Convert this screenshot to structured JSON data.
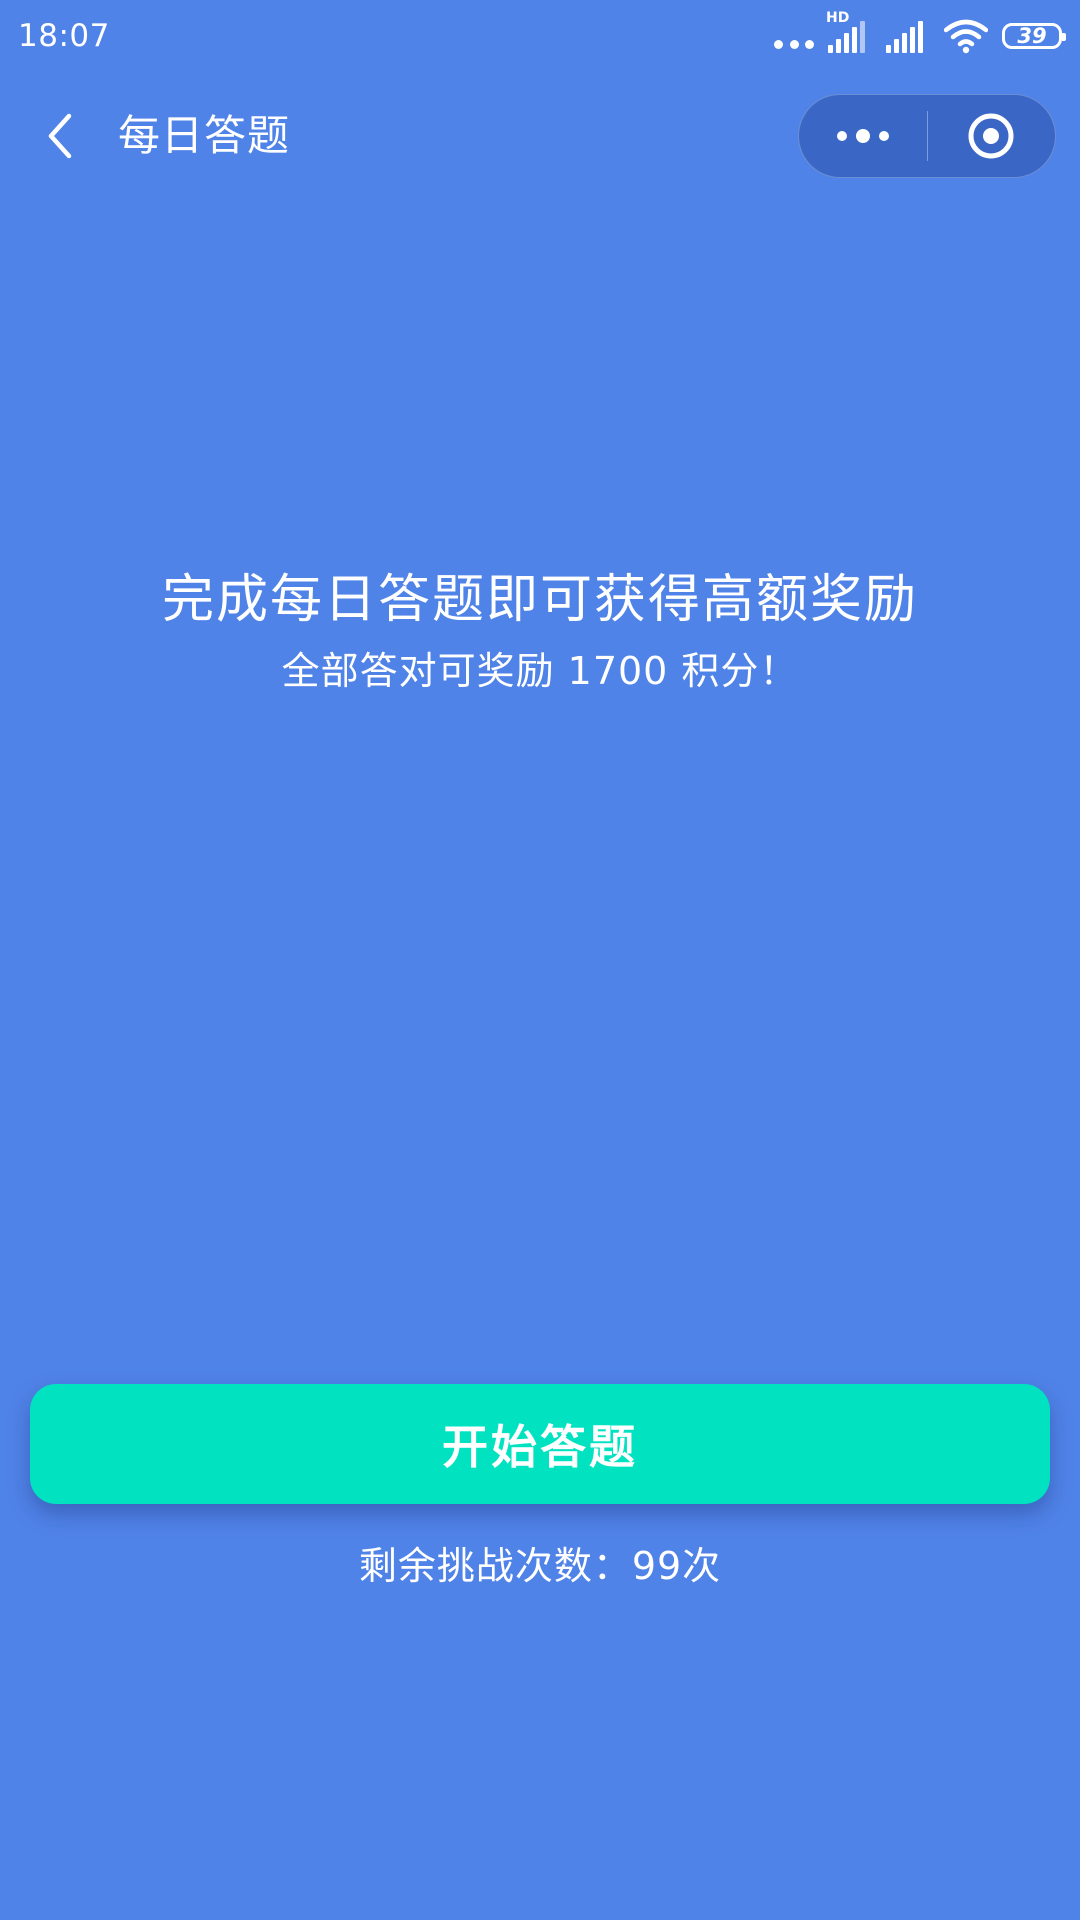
{
  "status_bar": {
    "time": "18:07",
    "network_label": "HD",
    "battery": "39"
  },
  "nav": {
    "title": "每日答题"
  },
  "content": {
    "headline": "完成每日答题即可获得高额奖励",
    "subline": "全部答对可奖励 1700 积分！"
  },
  "actions": {
    "start_label": "开始答题",
    "remaining_text": "剩余挑战次数：99次"
  },
  "colors": {
    "background": "#5083e8",
    "button": "#00e2c0"
  }
}
